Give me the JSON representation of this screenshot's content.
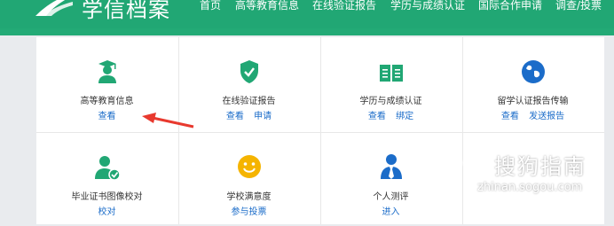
{
  "header": {
    "logo_text": "学信档案",
    "nav": [
      "首页",
      "高等教育信息",
      "在线验证报告",
      "学历与成绩认证",
      "国际合作申请",
      "调查/投票"
    ]
  },
  "colors": {
    "brand": "#21a774",
    "link": "#1b6cc9",
    "arrow": "#e8392e"
  },
  "cells": [
    {
      "icon": "graduate-icon",
      "title": "高等教育信息",
      "links": [
        "查看"
      ]
    },
    {
      "icon": "shield-check-icon",
      "title": "在线验证报告",
      "links": [
        "查看",
        "申请"
      ]
    },
    {
      "icon": "open-book-icon",
      "title": "学历与成绩认证",
      "links": [
        "查看",
        "绑定"
      ]
    },
    {
      "icon": "globe-icon",
      "title": "留学认证报告传输",
      "links": [
        "查看",
        "发送报告"
      ]
    },
    {
      "icon": "user-check-icon",
      "title": "毕业证书图像校对",
      "links": [
        "校对"
      ]
    },
    {
      "icon": "smiley-icon",
      "title": "学校满意度",
      "links": [
        "参与投票"
      ]
    },
    {
      "icon": "person-tie-icon",
      "title": "个人测评",
      "links": [
        "进入"
      ]
    }
  ],
  "watermark": {
    "text": "搜狗指南",
    "url": "zhinan.sogou.com"
  }
}
